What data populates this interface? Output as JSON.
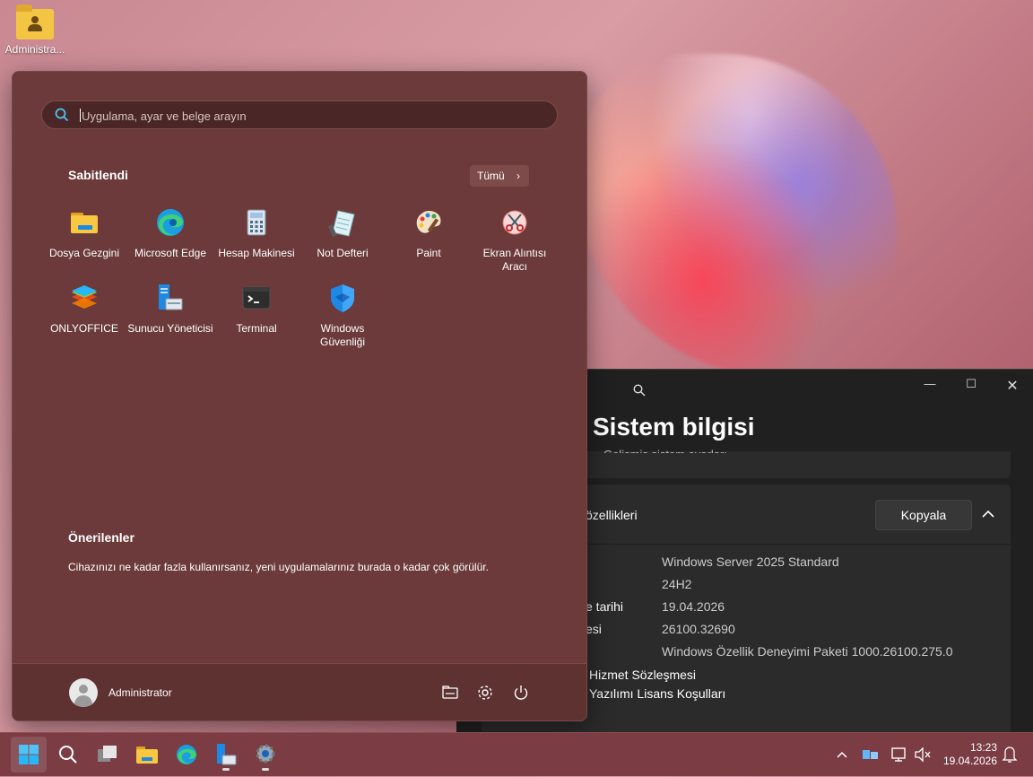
{
  "desktop": {
    "icon_label": "Administra..."
  },
  "start_menu": {
    "search_placeholder": "Uygulama, ayar ve belge arayın",
    "pinned_title": "Sabitlendi",
    "all_button": "Tümü",
    "apps": [
      {
        "label": "Dosya Gezgini",
        "icon": "file-explorer-icon"
      },
      {
        "label": "Microsoft Edge",
        "icon": "edge-icon"
      },
      {
        "label": "Hesap Makinesi",
        "icon": "calculator-icon"
      },
      {
        "label": "Not Defteri",
        "icon": "notepad-icon"
      },
      {
        "label": "Paint",
        "icon": "paint-icon"
      },
      {
        "label": "Ekran Alıntısı Aracı",
        "icon": "snipping-tool-icon"
      },
      {
        "label": "ONLYOFFICE",
        "icon": "onlyoffice-icon"
      },
      {
        "label": "Sunucu Yöneticisi",
        "icon": "server-manager-icon"
      },
      {
        "label": "Terminal",
        "icon": "terminal-icon"
      },
      {
        "label": "Windows Güvenliği",
        "icon": "windows-security-icon"
      }
    ],
    "recommended_title": "Önerilenler",
    "recommended_text": "Cihazınızı ne kadar fazla kullanırsanız, yeni uygulamalarınız burada o kadar çok görülür.",
    "user_name": "Administrator"
  },
  "settings": {
    "page_title": "Sistem bilgisi",
    "partial_link": "Gelişmiş sistem ayarları",
    "section_title": "özellikleri",
    "copy_button": "Kopyala",
    "spec_labels": [
      "e tarihi",
      "esi"
    ],
    "spec_values": [
      "Windows Server 2025 Standard",
      "24H2",
      "19.04.2026",
      "26100.32690",
      "Windows Özellik Deneyimi Paketi 1000.26100.275.0"
    ],
    "links": [
      "Hizmet Sözleşmesi",
      "Yazılımı Lisans Koşulları"
    ]
  },
  "taskbar": {
    "time": "13:23",
    "date": "19.04.2026"
  },
  "colors": {
    "start_bg": "#6c3a3a",
    "taskbar_bg": "#7b3c44",
    "settings_bg": "#202020"
  }
}
